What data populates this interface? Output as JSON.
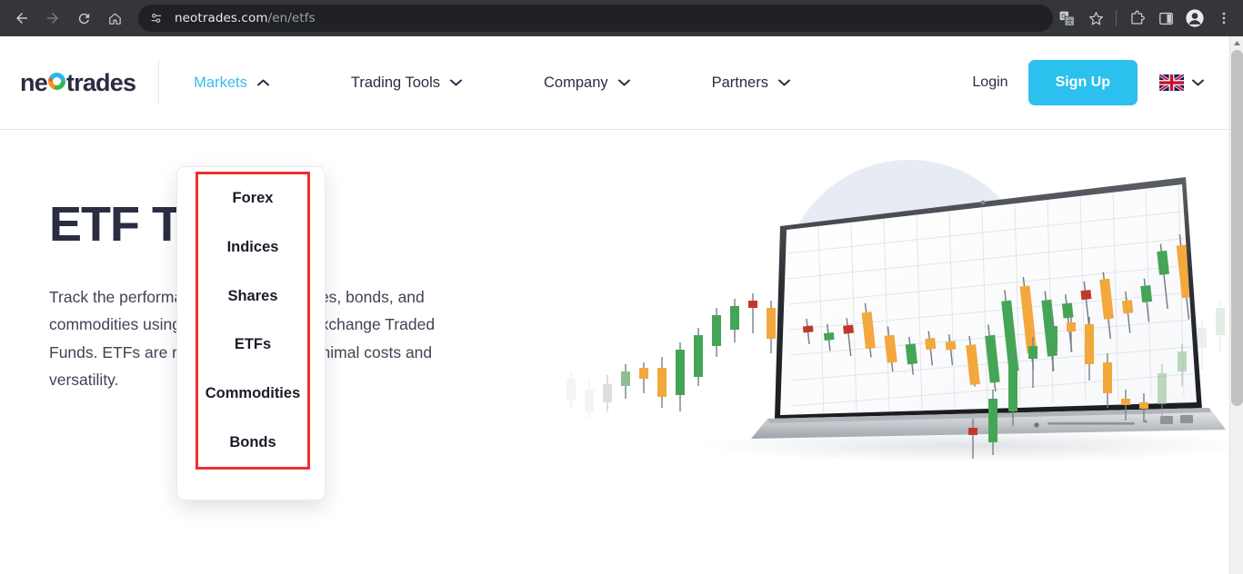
{
  "browser": {
    "back_icon": "back-arrow-icon",
    "forward_icon": "forward-arrow-icon",
    "reload_icon": "reload-icon",
    "home_icon": "home-icon",
    "site_info_icon": "site-settings-icon",
    "url_prefix": "neotrades.com",
    "url_path": "/en/etfs",
    "url_full": "neotrades.com/en/etfs",
    "translate_icon": "translate-icon",
    "bookmark_icon": "bookmark-star-icon",
    "extensions_icon": "extensions-puzzle-icon",
    "side_panel_icon": "side-panel-icon",
    "profile_icon": "profile-avatar-icon",
    "menu_icon": "three-dot-menu-icon"
  },
  "site": {
    "logo_text_before": "ne",
    "logo_text_after": "trades",
    "nav": [
      {
        "label": "Markets",
        "active": true,
        "chevron": "chevron-up-icon"
      },
      {
        "label": "Trading Tools",
        "active": false,
        "chevron": "chevron-down-icon"
      },
      {
        "label": "Company",
        "active": false,
        "chevron": "chevron-down-icon"
      },
      {
        "label": "Partners",
        "active": false,
        "chevron": "chevron-down-icon"
      }
    ],
    "login_label": "Login",
    "signup_label": "Sign Up",
    "language_flag": "uk-flag-icon",
    "language_chevron": "chevron-down-icon",
    "accent_color": "#2bc0ee",
    "text_color": "#2b2d42"
  },
  "dropdown": {
    "highlight_color": "#f03030",
    "items": [
      {
        "label": "Forex"
      },
      {
        "label": "Indices"
      },
      {
        "label": "Shares"
      },
      {
        "label": "ETFs"
      },
      {
        "label": "Commodities"
      },
      {
        "label": "Bonds"
      }
    ]
  },
  "hero": {
    "title": "ETF Trading",
    "paragraph": "Track the performance of shares, indices, bonds, and commodities using CFDs on popular Exchange Traded Funds. ETFs are renowned for their minimal costs and versatility.",
    "illustration": "laptop-candlestick-chart-illustration"
  },
  "scrollbar": {
    "up_arrow_icon": "scroll-up-arrow-icon"
  }
}
